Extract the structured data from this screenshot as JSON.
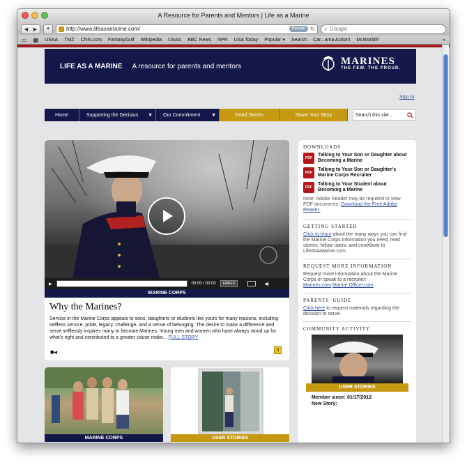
{
  "window": {
    "title": "A Resource for Parents and Mentors | Life as a Marine",
    "url": "http://www.lifeasamarine.com/",
    "reader_label": "Reader",
    "search_placeholder": "Google"
  },
  "bookmarks": [
    "USAA",
    "TMZ",
    "CNN.com",
    "FantasyGolf",
    "Wikipedia",
    "USAA",
    "BBC News",
    "NPR",
    "USA Today",
    "Popular",
    "Search",
    "Car...ama Action!",
    "McWorld®"
  ],
  "header": {
    "life": "LIFE AS A MARINE",
    "tagline": "A resource for parents and mentors",
    "logo_name": "MARINES",
    "logo_motto": "THE FEW. THE PROUD."
  },
  "signin": "Sign in",
  "nav": {
    "home": "Home",
    "supporting": "Supporting the Decision",
    "commitment": "Our Commitment",
    "read": "Read Stories",
    "share": "Share Your Story",
    "search_placeholder": "Search this site..."
  },
  "video": {
    "time": "00:00 / 00:00",
    "embed": "EMBED",
    "caption": "MARINE CORPS",
    "title": "Why the Marines?",
    "description": "Service in the Marine Corps appeals to sons, daughters or students like yours for many reasons, including selfless service, pride, legacy, challenge, and a sense of belonging. The desire to make a difference and serve selflessly inspires many to become Marines. Young men and women who have always stood up for what's right and contributed to a greater cause make...",
    "more": "FULL STORY",
    "comment_count": "3"
  },
  "tiles": [
    {
      "caption": "MARINE CORPS"
    },
    {
      "caption": "USER STORIES"
    }
  ],
  "sidebar": {
    "downloads_heading": "DOWNLOADS",
    "downloads": [
      "Talking to Your Son or Daughter about Becoming a Marine",
      "Talking to Your Son or Daughter's Marine Corps Recruiter",
      "Talking to Your Student about Becoming a Marine"
    ],
    "pdf_label": "PDF",
    "note": "Note: Adobe Reader may be required to view PDF documents.",
    "note_link": "Download the Free Adobe Reader.",
    "getting_started_heading": "GETTING STARTED",
    "getting_started_link": "Click to learn",
    "getting_started_text": "about the many ways you can find the Marine Corps information you need, read stories, follow users, and contribute to LifeAsAMarine.com.",
    "request_heading": "REQUEST MORE INFORMATION",
    "request_text": "Request more information about the Marine Corps or speak to a recruiter:",
    "request_link1": "Marines.com",
    "request_link2": "Marine Officer.com",
    "guide_heading": "PARENTS' GUIDE",
    "guide_link": "Click here",
    "guide_text": "to request materials regarding the decision to serve.",
    "community_heading": "COMMUNITY ACTIVITY",
    "community_caption": "USER STORIES",
    "member_since": "Member since: 01/17/2012",
    "new_story": "New Story:"
  }
}
